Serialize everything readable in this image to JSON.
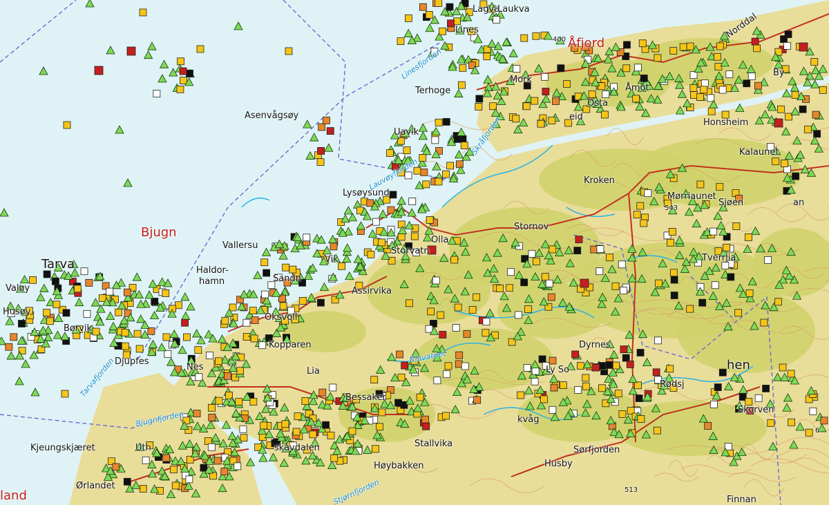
{
  "colors": {
    "sea": "#dff3f6",
    "land": "#e9dd9a",
    "forest": "#cfd26a",
    "contour": "#d9a26a",
    "road": "#c0301f",
    "boundary": "#6a6ad0",
    "river": "#27b3e8",
    "symbol_green": "#7ed957",
    "symbol_yellow": "#f5c518",
    "symbol_orange": "#e8862a",
    "symbol_red": "#c51f1f",
    "symbol_black": "#111111"
  },
  "places": [
    {
      "id": "lines",
      "text": "Lines"
    },
    {
      "id": "terhoge",
      "text": "Terhoge"
    },
    {
      "id": "asenvagsoy",
      "text": "Asenvågsøy"
    },
    {
      "id": "tarva",
      "text": "Tarva"
    },
    {
      "id": "valoy",
      "text": "Valøy"
    },
    {
      "id": "husoy",
      "text": "Husøy"
    },
    {
      "id": "borvik",
      "text": "Børvik"
    },
    {
      "id": "vallersund",
      "text": "Vallersu"
    },
    {
      "id": "haldorhamn1",
      "text": "Haldor-"
    },
    {
      "id": "haldorhamn2",
      "text": "hamn"
    },
    {
      "id": "sandnes",
      "text": "Sandn"
    },
    {
      "id": "oksvoll",
      "text": "Oksvoll"
    },
    {
      "id": "kopparen",
      "text": "Kopparen"
    },
    {
      "id": "djupfest",
      "text": "Djupfes"
    },
    {
      "id": "nes",
      "text": "Nes"
    },
    {
      "id": "lia",
      "text": "Lia"
    },
    {
      "id": "kjeungskjaeret",
      "text": "Kjeungskjæret"
    },
    {
      "id": "orlandet",
      "text": "Ørlandet"
    },
    {
      "id": "uthaug",
      "text": "Uth"
    },
    {
      "id": "skavdalen",
      "text": "skavdalen"
    },
    {
      "id": "stallvika",
      "text": "Stallvika"
    },
    {
      "id": "hoybakken",
      "text": "Høybakken"
    },
    {
      "id": "husby",
      "text": "Husby"
    },
    {
      "id": "sorfjorden",
      "text": "Sørfjorden"
    },
    {
      "id": "vag",
      "text": "kvåg"
    },
    {
      "id": "rodsjo",
      "text": "Rødsj"
    },
    {
      "id": "skorven",
      "text": "Skorven"
    },
    {
      "id": "tverrlia",
      "text": "Tverrlia"
    },
    {
      "id": "morriaunet",
      "text": "Mørriaunet"
    },
    {
      "id": "kaldaunet",
      "text": "Kalaunet"
    },
    {
      "id": "honsheim",
      "text": "Honsheim"
    },
    {
      "id": "by",
      "text": "By"
    },
    {
      "id": "norddal",
      "text": "Norddal"
    },
    {
      "id": "amot",
      "text": "Åmot"
    },
    {
      "id": "mork",
      "text": "Mork"
    },
    {
      "id": "osta",
      "text": "Osta"
    },
    {
      "id": "eid",
      "text": "eid"
    },
    {
      "id": "kroken",
      "text": "Kroken"
    },
    {
      "id": "stornova",
      "text": "Stornov"
    },
    {
      "id": "olla",
      "text": "Olla"
    },
    {
      "id": "lysoysund",
      "text": "Lysøysund"
    },
    {
      "id": "assirvika",
      "text": "Assirvika"
    },
    {
      "id": "storvatn",
      "text": "Storvatn"
    },
    {
      "id": "uavik",
      "text": "Uavik"
    },
    {
      "id": "bessaker",
      "text": "Bessaker"
    },
    {
      "id": "lagva",
      "text": "Lagva"
    },
    {
      "id": "vik",
      "text": "Vik"
    },
    {
      "id": "dyrnes",
      "text": "Dyrnes"
    },
    {
      "id": "lyso",
      "text": "Ly So"
    },
    {
      "id": "lauvdal",
      "text": "Laukva"
    },
    {
      "id": "sjoen",
      "text": "Sjøen"
    },
    {
      "id": "an",
      "text": "an"
    },
    {
      "id": "finnan",
      "text": "Finnan"
    },
    {
      "id": "hen",
      "text": "hen"
    }
  ],
  "region_labels": [
    {
      "id": "bjugn",
      "text": "Bjugn"
    },
    {
      "id": "land",
      "text": "land"
    },
    {
      "id": "afjord",
      "text": "Åfjord"
    }
  ],
  "water_labels": [
    {
      "id": "linesfjorden",
      "text": "Linesfjorden"
    },
    {
      "id": "skraefjorden",
      "text": "Skråfjorden"
    },
    {
      "id": "lauvoyfjorden",
      "text": "Lauvøyfjorden"
    },
    {
      "id": "tarvafjorden",
      "text": "Tarvafjorden"
    },
    {
      "id": "bjugnfjorden",
      "text": "Bjugnfjorden"
    },
    {
      "id": "stjornfjorden",
      "text": "Stjørnfjorden"
    },
    {
      "id": "njavatnet",
      "text": "Njavatnet"
    }
  ],
  "elevations": [
    "400",
    "543",
    "513",
    "6"
  ]
}
